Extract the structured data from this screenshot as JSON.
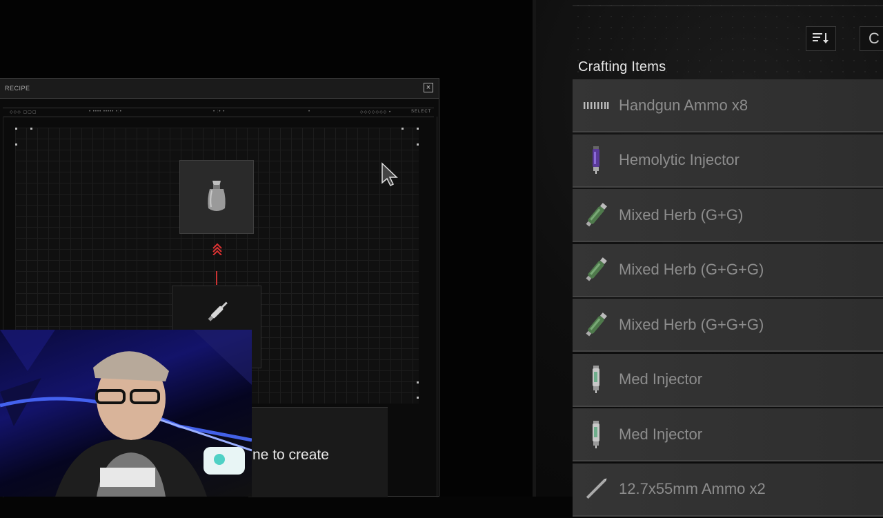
{
  "recipe": {
    "title": "RECIPE",
    "close_icon": "×",
    "strip_labels": [
      "◇◇◇ ▢▢▢",
      "• •••• ••••• •:•",
      "• :• •",
      "•",
      "◇◇◇◇◇◇◇ •",
      "SELECT"
    ],
    "create_text": "ne to create"
  },
  "crafting": {
    "title": "Crafting Items",
    "sort_icon": "sort-icon",
    "toggle_label": "C",
    "items": [
      {
        "label": "Handgun Ammo x8",
        "icon": "handgun-ammo-icon"
      },
      {
        "label": "Hemolytic Injector",
        "icon": "injector-purple-icon"
      },
      {
        "label": "Mixed Herb (G+G)",
        "icon": "herb-icon"
      },
      {
        "label": "Mixed Herb (G+G+G)",
        "icon": "herb-icon"
      },
      {
        "label": "Mixed Herb (G+G+G)",
        "icon": "herb-icon"
      },
      {
        "label": "Med Injector",
        "icon": "med-injector-icon"
      },
      {
        "label": "Med Injector",
        "icon": "med-injector-icon"
      },
      {
        "label": "12.7x55mm Ammo x2",
        "icon": "rifle-ammo-icon"
      }
    ]
  },
  "colors": {
    "accent_red": "#cc3333",
    "row_bg": "#353535",
    "label_gray": "#8d8d8d"
  }
}
